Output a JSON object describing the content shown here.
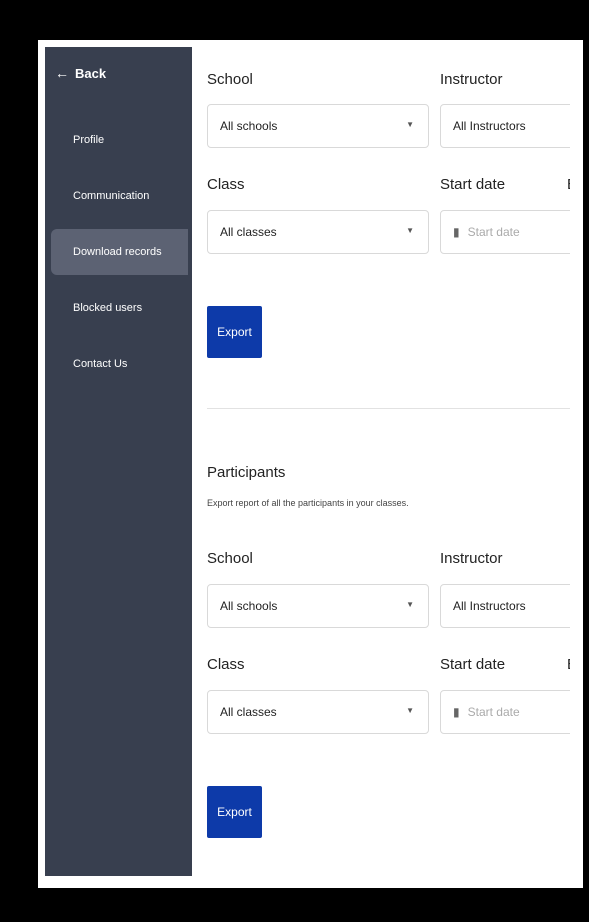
{
  "sidebar": {
    "back_label": "Back",
    "items": [
      {
        "label": "Profile"
      },
      {
        "label": "Communication"
      },
      {
        "label": "Download records"
      },
      {
        "label": "Blocked users"
      },
      {
        "label": "Contact Us"
      }
    ]
  },
  "form1": {
    "school_label": "School",
    "school_value": "All schools",
    "instructor_label": "Instructor",
    "instructor_value": "All Instructors",
    "class_label": "Class",
    "class_value": "All classes",
    "start_date_label": "Start date",
    "start_date_placeholder": "Start date",
    "end_date_label_cut": "E",
    "export_label": "Export"
  },
  "participants": {
    "title": "Participants",
    "subtitle": "Export report of all the participants in your classes.",
    "school_label": "School",
    "school_value": "All schools",
    "instructor_label": "Instructor",
    "instructor_value": "All Instructors",
    "class_label": "Class",
    "class_value": "All classes",
    "start_date_label": "Start date",
    "start_date_placeholder": "Start date",
    "end_date_label_cut": "E",
    "export_label": "Export"
  },
  "icons": {
    "back": "arrow-left-icon",
    "caret": "caret-down-icon",
    "calendar": "calendar-icon"
  }
}
